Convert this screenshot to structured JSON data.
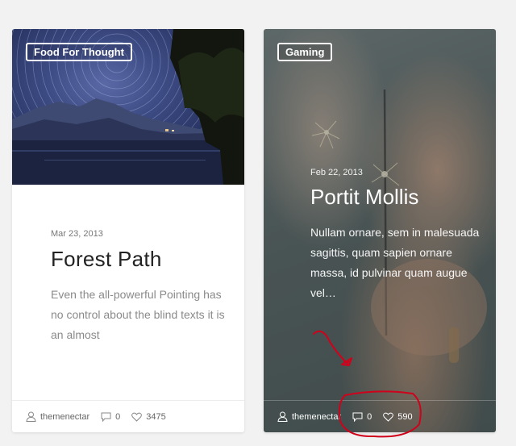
{
  "cards": [
    {
      "category": "Food For Thought",
      "date": "Mar 23, 2013",
      "title": "Forest Path",
      "excerpt": "Even the all-powerful Pointing has no control about the blind texts it is an almost",
      "author": "themenectar",
      "comments": "0",
      "likes": "3475"
    },
    {
      "category": "Gaming",
      "date": "Feb 22, 2013",
      "title": "Portit Mollis",
      "excerpt": "Nullam ornare, sem in malesuada sagittis, quam sapien ornare massa, id pulvinar quam augue vel…",
      "author": "themenectar",
      "comments": "0",
      "likes": "590"
    }
  ],
  "colors": {
    "annotation": "#d0021b"
  },
  "icons": [
    "user-icon",
    "comment-icon",
    "heart-icon"
  ]
}
